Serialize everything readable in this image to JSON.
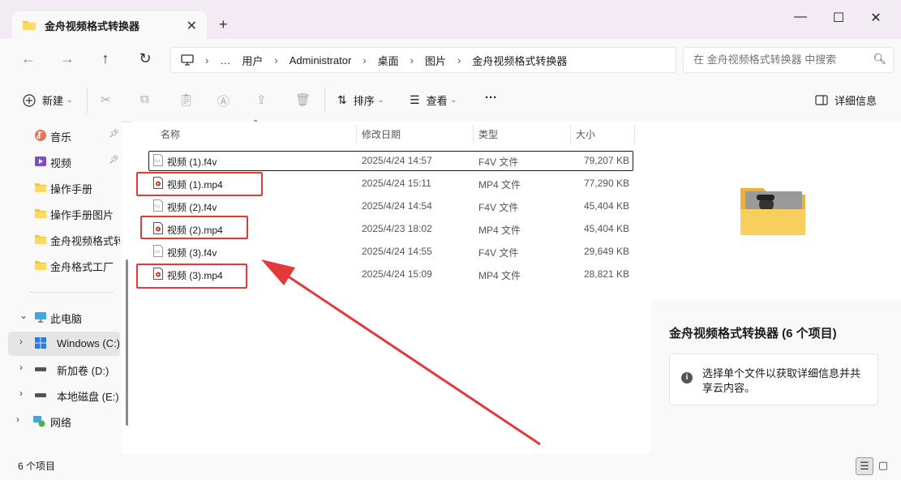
{
  "window": {
    "tab_title": "金舟视频格式转换器",
    "close_tab": "✕",
    "new_tab": "+",
    "minimize": "—",
    "maximize": "☐",
    "close": "✕"
  },
  "breadcrumb": {
    "items": [
      "…",
      "用户",
      "Administrator",
      "桌面",
      "图片",
      "金舟视频格式转换器"
    ],
    "separator": "›"
  },
  "search": {
    "placeholder": "在 金舟视频格式转换器 中搜索"
  },
  "toolbar": {
    "new_label": "新建",
    "sort_label": "排序",
    "view_label": "查看",
    "more_label": "···",
    "details_label": "详细信息"
  },
  "sidebar": {
    "quick_items": [
      {
        "label": "音乐",
        "pinned": true
      },
      {
        "label": "视频",
        "pinned": true
      },
      {
        "label": "操作手册"
      },
      {
        "label": "操作手册图片"
      },
      {
        "label": "金舟视频格式转"
      },
      {
        "label": "金舟格式工厂"
      }
    ],
    "this_pc": "此电脑",
    "drives": [
      "Windows (C:)",
      "新加卷 (D:)",
      "本地磁盘 (E:)"
    ],
    "network": "网络"
  },
  "columns": {
    "name": "名称",
    "date": "修改日期",
    "type": "类型",
    "size": "大小"
  },
  "files": [
    {
      "name": "视频 (1).f4v",
      "date": "2025/4/24 14:57",
      "type": "F4V 文件",
      "size": "79,207 KB",
      "kind": "f4v"
    },
    {
      "name": "视频 (1).mp4",
      "date": "2025/4/24 15:11",
      "type": "MP4 文件",
      "size": "77,290 KB",
      "kind": "mp4"
    },
    {
      "name": "视频 (2).f4v",
      "date": "2025/4/24 14:54",
      "type": "F4V 文件",
      "size": "45,404 KB",
      "kind": "f4v"
    },
    {
      "name": "视频 (2).mp4",
      "date": "2025/4/23 18:02",
      "type": "MP4 文件",
      "size": "45,404 KB",
      "kind": "mp4"
    },
    {
      "name": "视频 (3).f4v",
      "date": "2025/4/24 14:55",
      "type": "F4V 文件",
      "size": "29,649 KB",
      "kind": "f4v"
    },
    {
      "name": "视频 (3).mp4",
      "date": "2025/4/24 15:09",
      "type": "MP4 文件",
      "size": "28,821 KB",
      "kind": "mp4"
    }
  ],
  "details": {
    "title": "金舟视频格式转换器 (6 个项目)",
    "hint": "选择单个文件以获取详细信息并共享云内容。"
  },
  "status": {
    "count": "6 个项目"
  },
  "colors": {
    "highlight": "#e23a3a",
    "folder": "#f5c342"
  }
}
